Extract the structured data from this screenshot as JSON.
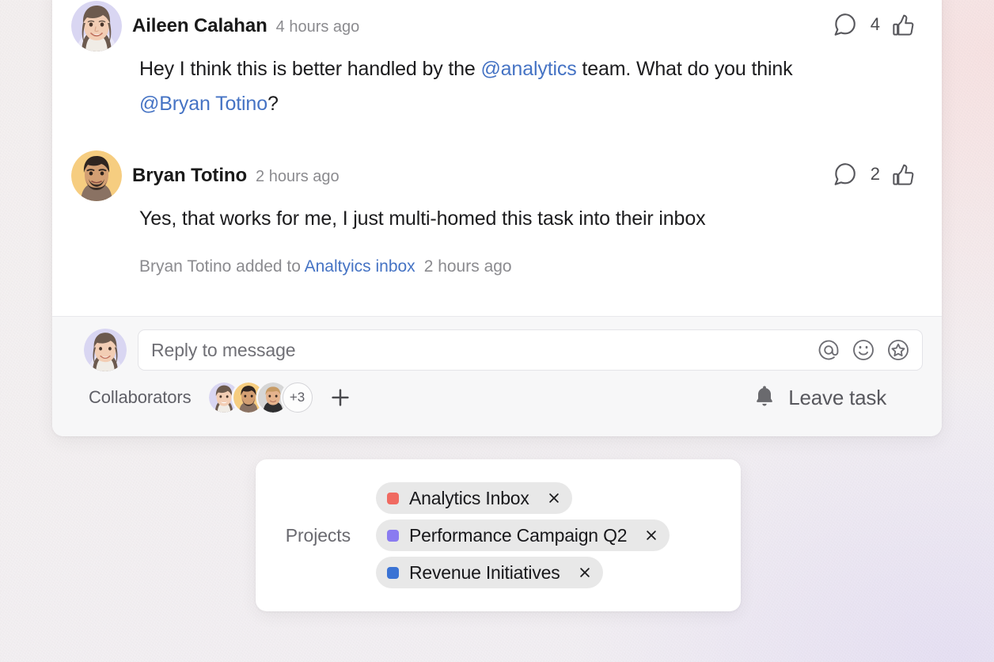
{
  "thread": {
    "messages": [
      {
        "author": "Aileen Calahan",
        "timestamp": "4 hours ago",
        "like_count": "4",
        "body_part1": "Hey I think this is better handled by the ",
        "body_mention1": "@analytics",
        "body_part2": " team. What do you think ",
        "body_mention2": "@Bryan Totino",
        "body_part3": "?",
        "avatar_name": "aileen-avatar",
        "avatar_bg": "#d9d6f2"
      },
      {
        "author": "Bryan Totino",
        "timestamp": "2 hours ago",
        "like_count": "2",
        "body_part1": "Yes, that works for me, I just multi-homed this task into their inbox",
        "body_mention1": "",
        "body_part2": "",
        "body_mention2": "",
        "body_part3": "",
        "avatar_name": "bryan-avatar",
        "avatar_bg": "#f6cd80"
      }
    ],
    "system_note": {
      "prefix": "Bryan Totino added to ",
      "link": "Analtyics inbox",
      "timestamp": "2 hours ago"
    }
  },
  "reply": {
    "placeholder": "Reply to message",
    "value": "",
    "tools": [
      {
        "name": "mention-icon",
        "title": "Mention someone"
      },
      {
        "name": "emoji-icon",
        "title": "Add emoji"
      },
      {
        "name": "star-icon",
        "title": "Add to favorites"
      }
    ]
  },
  "collaborators": {
    "label": "Collaborators",
    "avatars": [
      {
        "name": "collaborator-avatar-aileen",
        "bg": "#d9d6f2"
      },
      {
        "name": "collaborator-avatar-bryan",
        "bg": "#f6cd80"
      },
      {
        "name": "collaborator-avatar-third",
        "bg": "#d6d6d6"
      }
    ],
    "overflow_label": "+3",
    "add_label": "+"
  },
  "leave_task": {
    "label": "Leave task",
    "icon": "bell-icon"
  },
  "projects": {
    "label": "Projects",
    "items": [
      {
        "label": "Analytics Inbox",
        "color": "#f06a61"
      },
      {
        "label": "Performance Campaign Q2",
        "color": "#8a7bf0"
      },
      {
        "label": "Revenue Initiatives",
        "color": "#3b73d4"
      }
    ]
  },
  "colors": {
    "link": "#4573c4",
    "card_bg": "#ffffff",
    "footer_bg": "#f7f7f8",
    "chip_bg": "#e8e8e8",
    "text_primary": "#1c1c1e",
    "text_muted": "#8b8b8f"
  }
}
